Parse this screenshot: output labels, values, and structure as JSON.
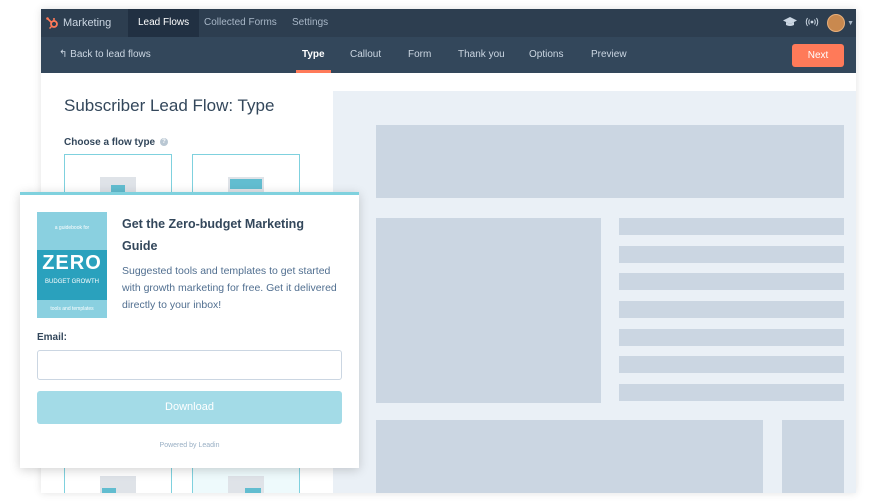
{
  "topnav": {
    "brand": "Marketing",
    "tabs": [
      "Lead Flows",
      "Collected Forms",
      "Settings"
    ],
    "active_tab": "Lead Flows",
    "icons": [
      "graduation-cap-icon",
      "broadcast-icon",
      "avatar"
    ]
  },
  "subnav": {
    "back_label": "Back to lead flows",
    "steps": [
      "Type",
      "Callout",
      "Form",
      "Thank you",
      "Options",
      "Preview"
    ],
    "active_step": "Type",
    "next_label": "Next"
  },
  "leftpanel": {
    "title": "Subscriber Lead Flow: Type",
    "flow_type_label": "Choose a flow type",
    "help_icon": "?"
  },
  "popup": {
    "book": {
      "tagline_top": "a guidebook for",
      "big_word": "ZERO",
      "sub_word": "BUDGET GROWTH",
      "tagline_bottom": "tools and templates"
    },
    "title": "Get the Zero-budget Marketing Guide",
    "description": "Suggested tools and templates to get started with growth marketing for free. Get it delivered directly to your inbox!",
    "email_label": "Email:",
    "email_value": "",
    "email_placeholder": "",
    "button_label": "Download",
    "powered_by": "Powered by Leadin"
  },
  "colors": {
    "nav_dark": "#2d3e50",
    "subnav": "#33475b",
    "accent_orange": "#ff7a59",
    "teal": "#7fd1de",
    "preview_bg": "#eaf0f6",
    "placeholder_block": "#cbd6e2"
  }
}
